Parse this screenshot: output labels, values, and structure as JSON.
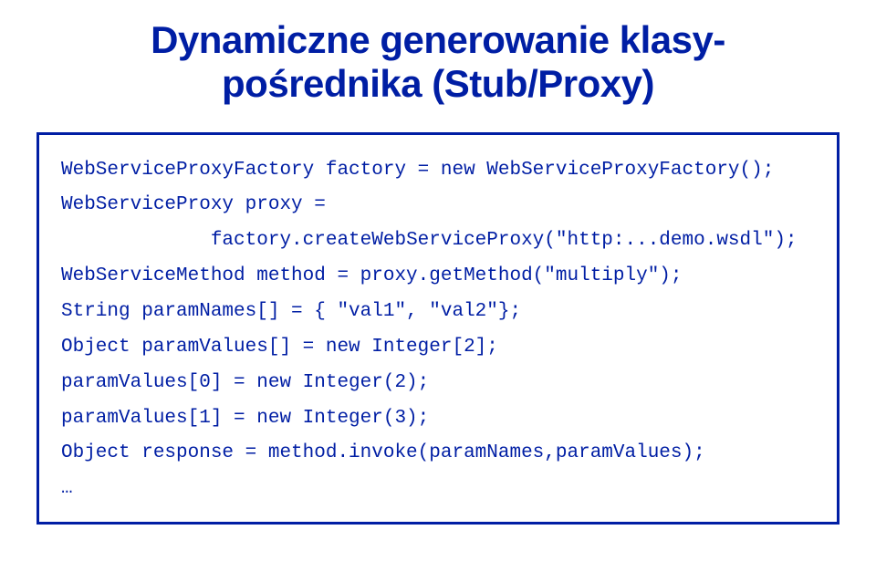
{
  "title_line1": "Dynamiczne generowanie klasy-",
  "title_line2": "pośrednika (Stub/Proxy)",
  "code": {
    "l1": "WebServiceProxyFactory factory = new WebServiceProxyFactory();",
    "l2": "WebServiceProxy proxy =",
    "l3": "             factory.createWebServiceProxy(\"http:...demo.wsdl\");",
    "l4": "WebServiceMethod method = proxy.getMethod(\"multiply\");",
    "l5": "String paramNames[] = { \"val1\", \"val2\"};",
    "l6": "Object paramValues[] = new Integer[2];",
    "l7": "paramValues[0] = new Integer(2);",
    "l8": "paramValues[1] = new Integer(3);",
    "l9": "Object response = method.invoke(paramNames,paramValues);",
    "l10": "…"
  }
}
